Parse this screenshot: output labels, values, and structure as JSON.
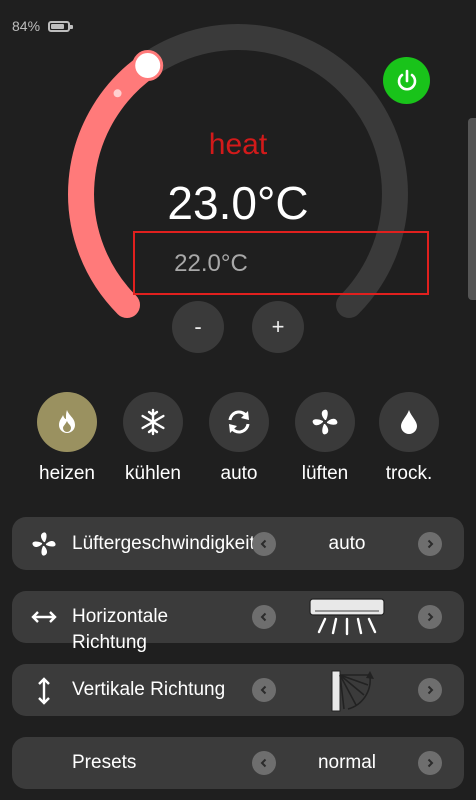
{
  "status": {
    "battery": "84%",
    "battery_level": 0.84
  },
  "thermostat": {
    "mode": "heat",
    "current_temp": "23.0°C",
    "target_temp": "22.0°C",
    "minus_label": "-",
    "plus_label": "+",
    "dial_fill_fraction": 0.37,
    "colors": {
      "active_arc": "#ff7a7a",
      "track": "#3a3a3a",
      "mode_text": "#d21a1a",
      "power": "#19c31a",
      "highlight_box": "#e0201e"
    }
  },
  "modes": [
    {
      "label": "heizen",
      "icon": "flame-icon",
      "active": true
    },
    {
      "label": "kühlen",
      "icon": "snowflake-icon",
      "active": false
    },
    {
      "label": "auto",
      "icon": "refresh-icon",
      "active": false
    },
    {
      "label": "lüften",
      "icon": "fan-icon",
      "active": false
    },
    {
      "label": "trock.",
      "icon": "droplet-icon",
      "active": false
    }
  ],
  "settings": {
    "fan_speed": {
      "label": "Lüftergeschwindigkeit",
      "value": "auto",
      "icon": "fan-icon"
    },
    "horizontal": {
      "label_line1": "Horizontale",
      "label_line2": "Richtung",
      "icon": "horizontal-arrows-icon",
      "value_icon": "ac-horizontal-swing-icon"
    },
    "vertical": {
      "label": "Vertikale Richtung",
      "icon": "vertical-arrows-icon",
      "value_icon": "vertical-swing-icon"
    },
    "presets": {
      "label": "Presets",
      "value": "normal"
    }
  }
}
